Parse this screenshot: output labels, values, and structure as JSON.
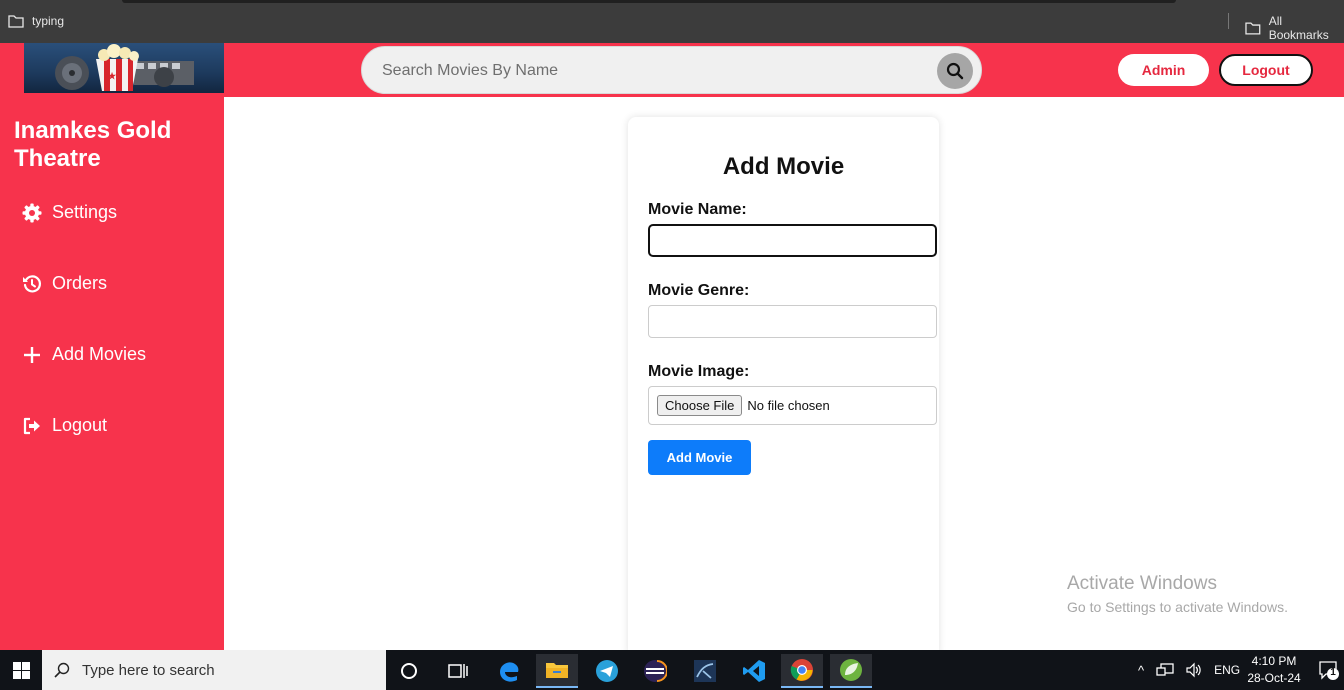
{
  "browser": {
    "bookmark_left": "typing",
    "bookmark_right": "All Bookmarks"
  },
  "header": {
    "search_placeholder": "Search Movies By Name",
    "admin_label": "Admin",
    "logout_label": "Logout"
  },
  "sidebar": {
    "brand": "Inamkes Gold Theatre",
    "items": [
      {
        "label": "Settings",
        "icon": "gear-icon"
      },
      {
        "label": "Orders",
        "icon": "history-icon"
      },
      {
        "label": "Add Movies",
        "icon": "plus-icon"
      },
      {
        "label": "Logout",
        "icon": "logout-icon"
      }
    ]
  },
  "form": {
    "title": "Add Movie",
    "name_label": "Movie Name:",
    "name_value": "",
    "genre_label": "Movie Genre:",
    "genre_value": "",
    "image_label": "Movie Image:",
    "file_button": "Choose File",
    "file_status": "No file chosen",
    "submit_label": "Add Movie"
  },
  "watermark": {
    "title": "Activate Windows",
    "subtitle": "Go to Settings to activate Windows."
  },
  "taskbar": {
    "search_placeholder": "Type here to search",
    "language": "ENG",
    "time": "4:10 PM",
    "date": "28-Oct-24",
    "notification_count": "1"
  },
  "colors": {
    "brand_red": "#f7334c",
    "primary_blue": "#0d7cfa"
  }
}
